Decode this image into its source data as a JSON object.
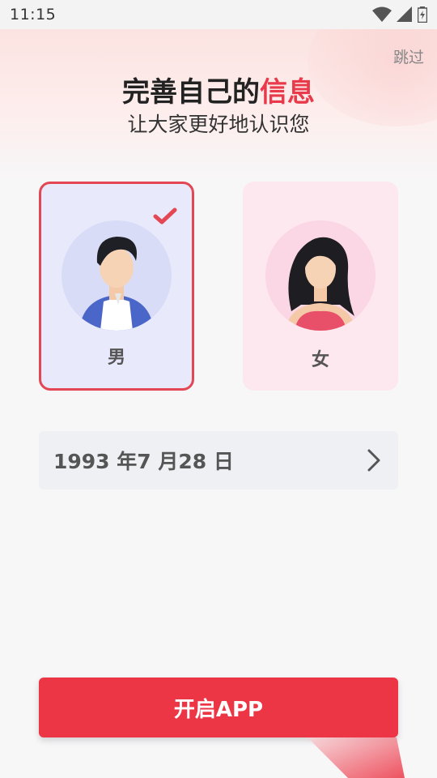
{
  "status_bar": {
    "time": "11:15",
    "icons": [
      "wifi-icon",
      "signal-icon",
      "battery-icon"
    ]
  },
  "header": {
    "skip_label": "跳过",
    "title_main": "完善自己的",
    "title_accent": "信息",
    "subtitle": "让大家更好地认识您"
  },
  "gender": {
    "male_label": "男",
    "female_label": "女",
    "selected": "male"
  },
  "birthday": {
    "value": "1993 年7 月28 日"
  },
  "actions": {
    "start_label": "开启APP"
  },
  "colors": {
    "accent": "#e83a4a",
    "button": "#ec3545",
    "male_card_bg": "#e8e9fb",
    "female_card_bg": "#fde8f0"
  }
}
